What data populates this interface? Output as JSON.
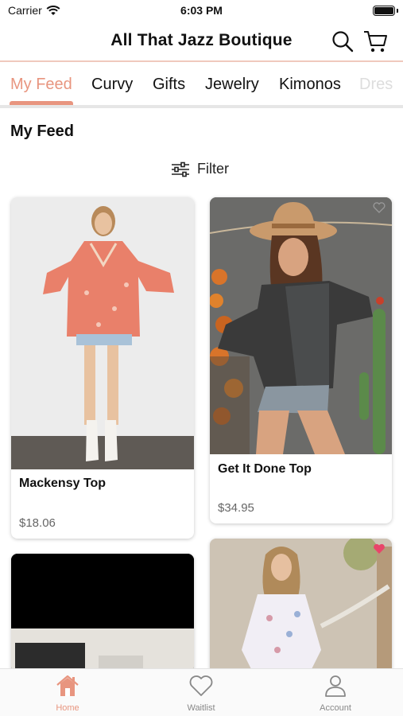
{
  "status": {
    "carrier": "Carrier",
    "time": "6:03 PM"
  },
  "header": {
    "title": "All That Jazz Boutique"
  },
  "tabs": [
    {
      "label": "My Feed",
      "active": true
    },
    {
      "label": "Curvy"
    },
    {
      "label": "Gifts"
    },
    {
      "label": "Jewelry"
    },
    {
      "label": "Kimonos"
    },
    {
      "label": "Dres"
    }
  ],
  "section_title": "My Feed",
  "filter_label": "Filter",
  "products": [
    {
      "name": "Mackensy Top",
      "price": "$18.06"
    },
    {
      "name": "Get It Done Top",
      "price": "$34.95"
    }
  ],
  "bottom_nav": [
    {
      "label": "Home",
      "active": true
    },
    {
      "label": "Waitlist"
    },
    {
      "label": "Account"
    }
  ],
  "colors": {
    "accent": "#e8957f",
    "divider": "#f0c9bd"
  }
}
